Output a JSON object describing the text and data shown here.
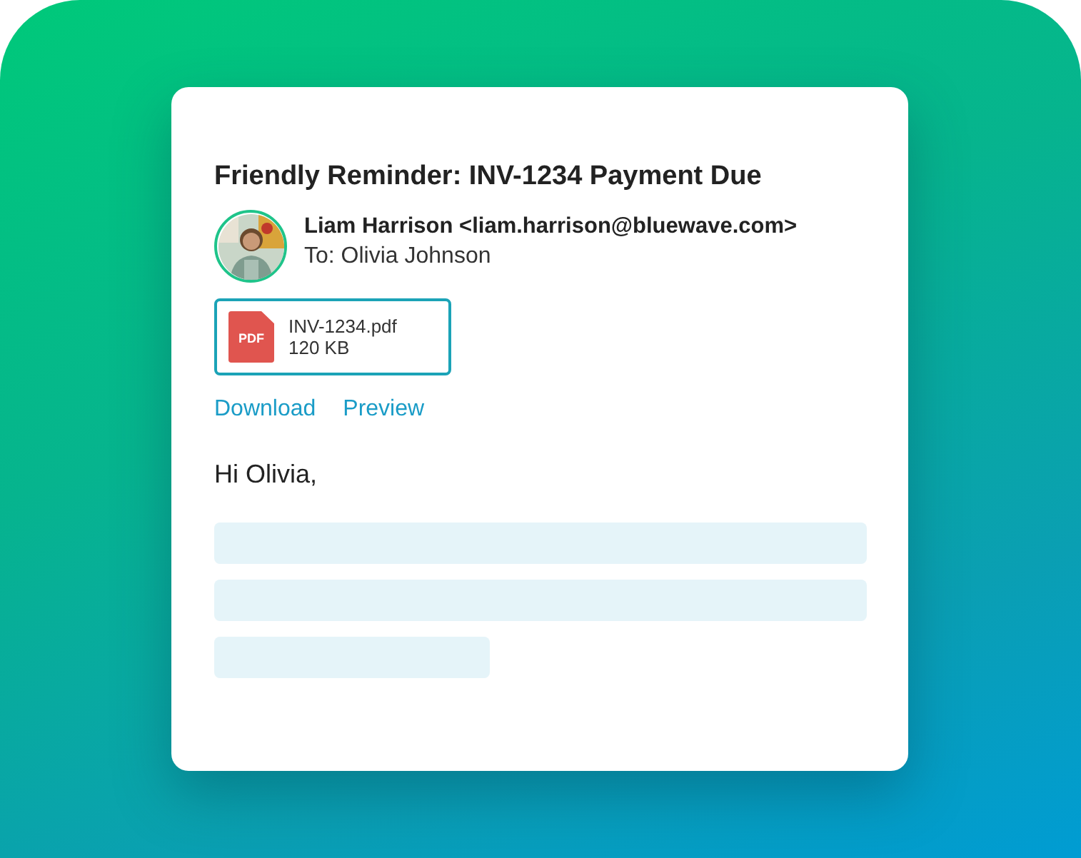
{
  "email": {
    "subject": "Friendly Reminder: INV-1234 Payment Due",
    "sender": "Liam Harrison <liam.harrison@bluewave.com>",
    "recipient": "To: Olivia Johnson",
    "avatar": {
      "kind": "picture"
    },
    "attachment": {
      "badge": "PDF",
      "filename": "INV-1234.pdf",
      "size": "120 KB"
    },
    "actions": [
      "Download",
      "Preview"
    ],
    "greeting": "Hi Olivia,",
    "body_lines": [
      {
        "kind": "full"
      },
      {
        "kind": "full"
      },
      {
        "kind": "short"
      }
    ]
  }
}
